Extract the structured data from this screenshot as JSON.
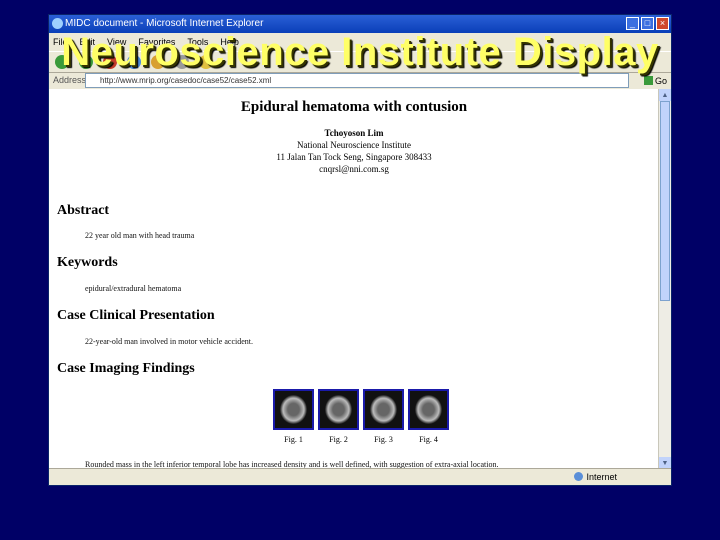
{
  "slide": {
    "title": "Neuroscience Institute Display"
  },
  "window": {
    "title": "MIDC document - Microsoft Internet Explorer",
    "menu": [
      "File",
      "Edit",
      "View",
      "Favorites",
      "Tools",
      "Help"
    ],
    "address_label": "Address",
    "address_url": "http://www.mrip.org/casedoc/case52/case52.xml",
    "go_label": "Go",
    "status_zone": "Internet"
  },
  "document": {
    "title": "Epidural hematoma with contusion",
    "author": {
      "name": "Tchoyoson Lim",
      "institution": "National Neuroscience Institute",
      "address": "11 Jalan Tan Tock Seng, Singapore 308433",
      "email": "cnqrsl@nni.com.sg"
    },
    "sections": [
      {
        "heading": "Abstract",
        "text": "22 year old man with head trauma"
      },
      {
        "heading": "Keywords",
        "text": "epidural/extradural hematoma"
      },
      {
        "heading": "Case Clinical Presentation",
        "text": "22-year-old man involved in motor vehicle accident."
      },
      {
        "heading": "Case Imaging Findings",
        "text": "Rounded mass in the left inferior temporal lobe has increased density and is well defined, with suggestion of extra-axial location."
      }
    ],
    "figure_captions": [
      "Fig. 1",
      "Fig. 2",
      "Fig. 3",
      "Fig. 4"
    ]
  },
  "colors": {
    "background": "#000066",
    "title": "#ffff66",
    "titlebar": "#0a3fb8"
  }
}
